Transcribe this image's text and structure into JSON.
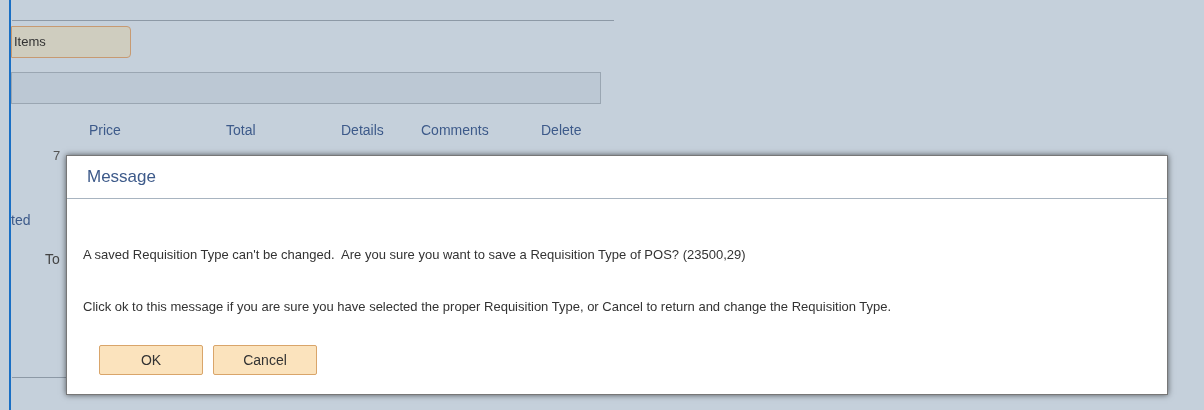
{
  "page": {
    "items_button": "Items",
    "columns": [
      "Price",
      "Total",
      "Details",
      "Comments",
      "Delete"
    ],
    "row_value": "7",
    "left_label": "ted",
    "total_label": "To"
  },
  "dialog": {
    "title": "Message",
    "messages": [
      "A saved Requisition Type can't be changed.  Are you sure you want to save a Requisition Type of POS? (23500,29)",
      "Click ok to this message if you are sure you have selected the proper Requisition Type, or Cancel to return and change the Requisition Type."
    ],
    "buttons": [
      "OK",
      "Cancel"
    ]
  }
}
